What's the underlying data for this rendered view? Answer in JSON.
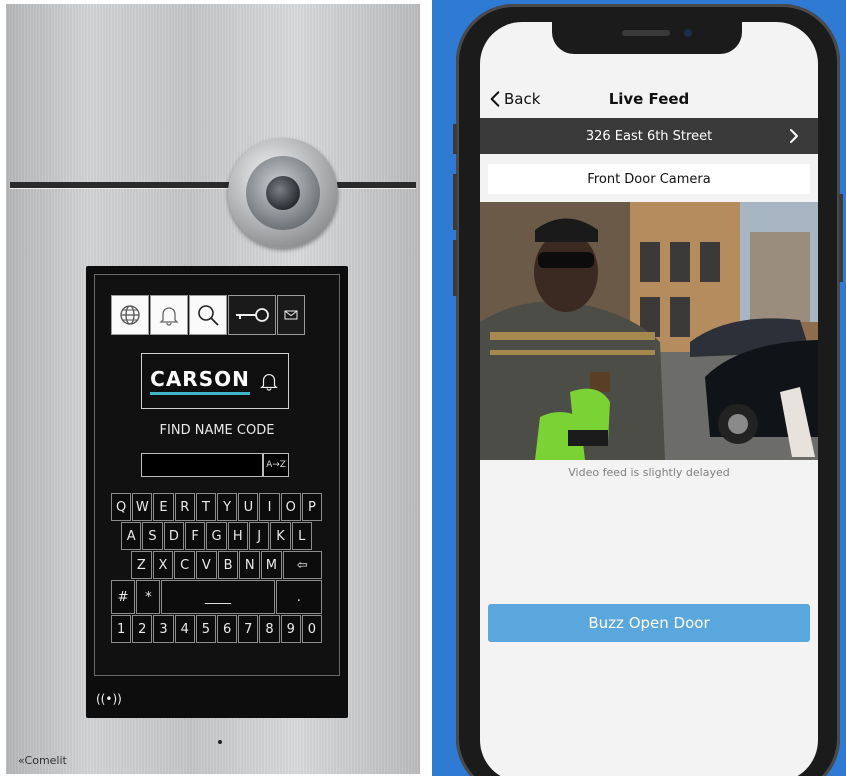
{
  "intercom": {
    "brand": "CARSON",
    "find_label": "FIND NAME CODE",
    "az_label": "A→Z",
    "tabs": [
      "globe-icon",
      "bell-icon",
      "search-icon",
      "key-icon",
      "envelope-icon"
    ],
    "keyboard_rows": [
      [
        "Q",
        "W",
        "E",
        "R",
        "T",
        "Y",
        "U",
        "I",
        "O",
        "P"
      ],
      [
        "A",
        "S",
        "D",
        "F",
        "G",
        "H",
        "J",
        "K",
        "L"
      ],
      [
        "Z",
        "X",
        "C",
        "V",
        "B",
        "N",
        "M",
        "⇦"
      ],
      [
        "#",
        "*",
        "____",
        "."
      ],
      [
        "1",
        "2",
        "3",
        "4",
        "5",
        "6",
        "7",
        "8",
        "9",
        "0"
      ]
    ],
    "nfc_label": "((•))",
    "manufacturer": "«Comelit"
  },
  "app": {
    "back_label": "Back",
    "title": "Live Feed",
    "address": "326 East 6th Street",
    "camera_name": "Front Door Camera",
    "delay_note": "Video feed is slightly delayed",
    "buzz_label": "Buzz Open Door"
  },
  "colors": {
    "accent": "#5aa7dd",
    "background": "#2f7ad3",
    "brand_underline": "#41b4c9"
  }
}
